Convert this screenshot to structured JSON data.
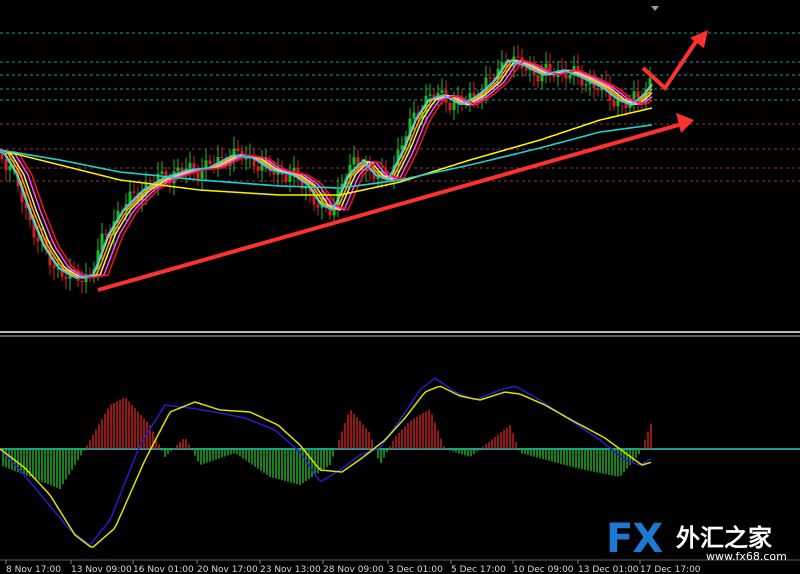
{
  "chart_data": [
    {
      "type": "candlestick",
      "panel": "price",
      "grid": false,
      "horizontal_levels_style": "dotted",
      "level_colors": [
        "#20c0c0",
        "#20c0c0",
        "#20c0c0",
        "#20c0c0",
        "#20c0c0",
        "#c04040",
        "#c04040",
        "#c04040",
        "#c04040"
      ],
      "candle_colors": {
        "up": "#1fb81f",
        "down": "#d42020",
        "neutral": "#b8b820"
      },
      "moving_averages": [
        {
          "color": "#ffd700"
        },
        {
          "color": "#ff9a1a"
        },
        {
          "color": "#e8e870"
        },
        {
          "color": "#ff40ff"
        },
        {
          "color": "#e01818"
        },
        {
          "color": "#20c8ff"
        },
        {
          "color": "#f8f000"
        },
        {
          "color": "#20d0d0"
        }
      ],
      "annotations": [
        {
          "kind": "arrow",
          "color": "#ff3030",
          "meaning": "rising trendline"
        },
        {
          "kind": "arrow",
          "color": "#ff3030",
          "meaning": "projected upward move"
        }
      ]
    },
    {
      "type": "histogram_with_lines",
      "panel": "oscillator",
      "zero_line_color": "#20d0d0",
      "histogram_colors": {
        "positive": "#d42020",
        "negative": "#1fb81f"
      },
      "lines": [
        {
          "color": "#2020c8"
        },
        {
          "color": "#e0e000"
        }
      ]
    }
  ],
  "x_axis": {
    "labels": [
      "8 Nov 17:00",
      "13 Nov 09:00",
      "16 Nov 01:00",
      "20 Nov 17:00",
      "23 Nov 13:00",
      "28 Nov 09:00",
      "3 Dec 01:00",
      "5 Dec 17:00",
      "10 Dec 09:00",
      "13 Dec 01:00",
      "17 Dec 17:00"
    ]
  },
  "logo": {
    "mark": "FX",
    "name": "外汇之家",
    "url": "www.fx68.com"
  }
}
